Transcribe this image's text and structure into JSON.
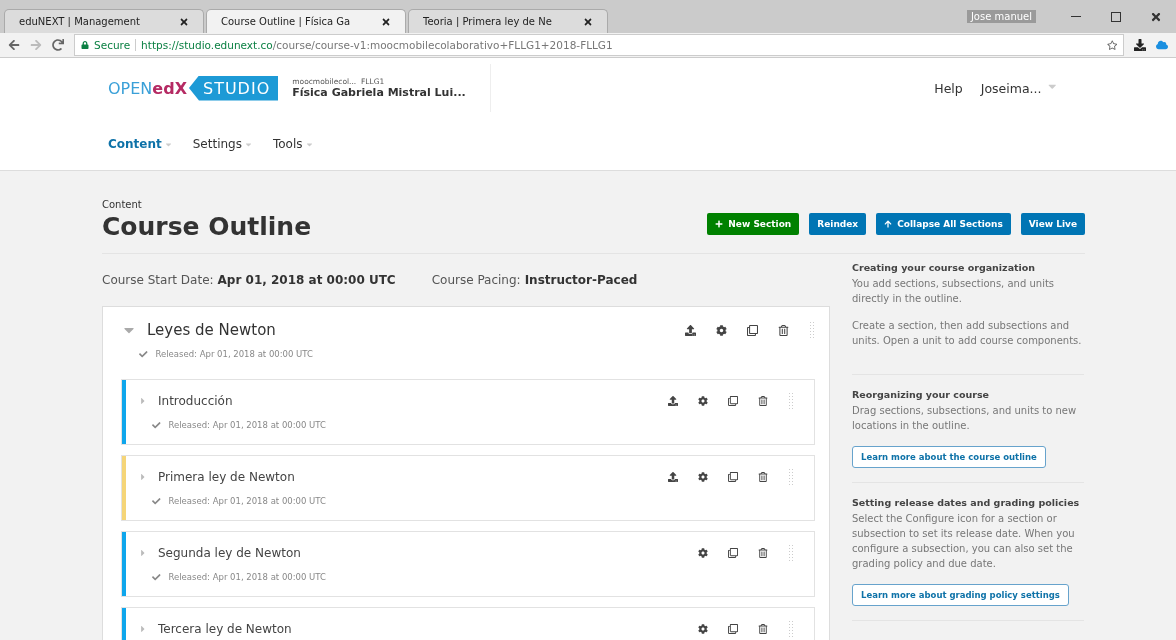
{
  "browser": {
    "tabs": [
      {
        "label": "eduNEXT | Management",
        "selected": false
      },
      {
        "label": "Course Outline | Física Ga",
        "selected": true
      },
      {
        "label": "Teoria | Primera ley de Ne",
        "selected": false
      }
    ],
    "profile": "Jose manuel",
    "secure": "Secure",
    "url_host": "https://studio.edunext.co",
    "url_path": "/course/course-v1:moocmobilecolaborativo+FLLG1+2018-FLLG1"
  },
  "header": {
    "logo_open": "OPEN",
    "logo_edx": "edX",
    "logo_studio": "STUDIO",
    "course_org": "moocmobilecol...",
    "course_number": "FLLG1",
    "course_title": "Física Gabriela Mistral Lui...",
    "help": "Help",
    "user": "Joseima...",
    "nav": [
      {
        "label": "Content",
        "selected": true
      },
      {
        "label": "Settings",
        "selected": false
      },
      {
        "label": "Tools",
        "selected": false
      }
    ]
  },
  "page": {
    "subtitle": "Content",
    "title": "Course Outline",
    "actions": [
      {
        "label": "New Section",
        "kind": "add"
      },
      {
        "label": "Reindex",
        "kind": "plain"
      },
      {
        "label": "Collapse All Sections",
        "kind": "collapse"
      },
      {
        "label": "View Live",
        "kind": "plain"
      }
    ],
    "start_label": "Course Start Date:",
    "start_value": "Apr 01, 2018 at 00:00 UTC",
    "pacing_label": "Course Pacing:",
    "pacing_value": "Instructor-Paced"
  },
  "section": {
    "title": "Leyes de Newton",
    "expanded": true,
    "status": "Released: Apr 01, 2018 at 00:00 UTC",
    "subsections": [
      {
        "title": "Introducción",
        "status": "Released: Apr 01, 2018 at 00:00 UTC",
        "color": "#0ea6ec",
        "publish": true
      },
      {
        "title": "Primera ley de Newton",
        "status": "Released: Apr 01, 2018 at 00:00 UTC",
        "color": "#f5d578",
        "publish": true
      },
      {
        "title": "Segunda ley de Newton",
        "status": "Released: Apr 01, 2018 at 00:00 UTC",
        "color": "#0ea6ec",
        "publish": false
      },
      {
        "title": "Tercera ley de Newton",
        "color": "#0ea6ec",
        "publish": false
      }
    ]
  },
  "sidebar": [
    {
      "heading": "Creating your course organization",
      "paragraphs": [
        "You add sections, subsections, and units directly in the outline.",
        "Create a section, then add subsections and units. Open a unit to add course components."
      ]
    },
    {
      "heading": "Reorganizing your course",
      "paragraphs": [
        "Drag sections, subsections, and units to new locations in the outline."
      ],
      "link": "Learn more about the course outline"
    },
    {
      "heading": "Setting release dates and grading policies",
      "paragraphs": [
        "Select the Configure icon for a section or subsection to set its release date. When you configure a subsection, you can also set the grading policy and due date."
      ],
      "link": "Learn more about grading policy settings"
    }
  ]
}
